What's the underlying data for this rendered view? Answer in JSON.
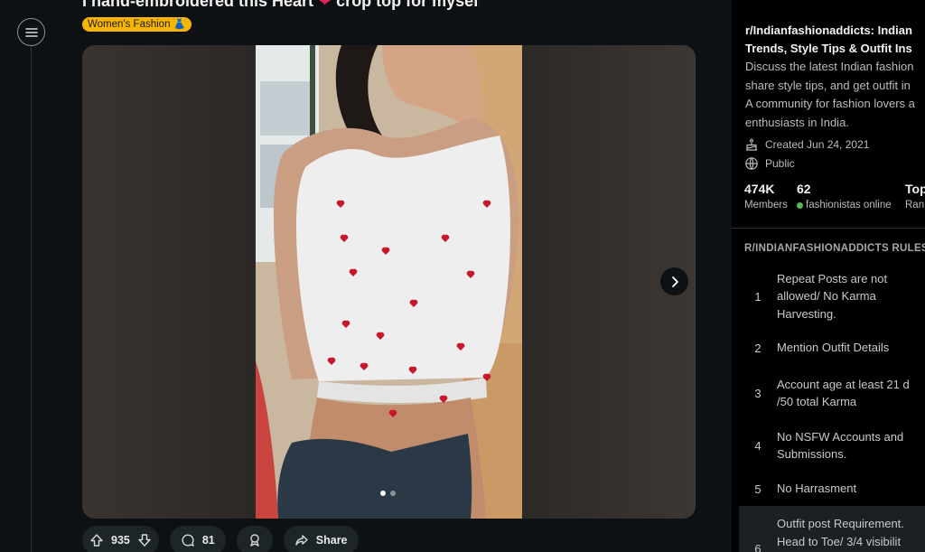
{
  "post": {
    "title_before": "I hand-embroidered this Heart",
    "title_heart": "❤",
    "title_after": "crop top for myself",
    "flair": "Women's Fashion 👗",
    "carousel_total": 2,
    "carousel_active": 1,
    "upvotes": "935",
    "comments": "81",
    "share_label": "Share"
  },
  "sidebar": {
    "title_line1": "r/Indianfashionaddicts: Indian",
    "title_line2": "Trends, Style Tips & Outfit Ins",
    "desc_lines": [
      "Discuss the latest Indian fashion",
      "share style tips, and get outfit in",
      "A community for fashion lovers a",
      "enthusiasts in India."
    ],
    "created": "Created Jun 24, 2021",
    "visibility": "Public",
    "members_count": "474K",
    "members_label": "Members",
    "online_count": "62",
    "online_label": "fashionistas online",
    "rank_count": "Top",
    "rank_label": "Ran",
    "rules_heading": "R/INDIANFASHIONADDICTS RULES",
    "rules": [
      {
        "num": "1",
        "lines": [
          "Repeat Posts are not",
          "allowed/ No Karma",
          "Harvesting."
        ]
      },
      {
        "num": "2",
        "lines": [
          "Mention Outfit Details"
        ]
      },
      {
        "num": "3",
        "lines": [
          "Account age at least 21 d",
          "/50 total Karma"
        ]
      },
      {
        "num": "4",
        "lines": [
          "No NSFW Accounts and",
          "Submissions."
        ]
      },
      {
        "num": "5",
        "lines": [
          "No Harrasment"
        ]
      },
      {
        "num": "6",
        "lines": [
          "Outfit post Requirement.",
          "Head to Toe/ 3/4 visibilit"
        ]
      }
    ]
  },
  "colors": {
    "background": "#0e1113",
    "sidebar": "#000000",
    "flair": "#f7b500",
    "heart": "#e0245e",
    "pill": "#1e2528",
    "online": "#55b85a"
  }
}
